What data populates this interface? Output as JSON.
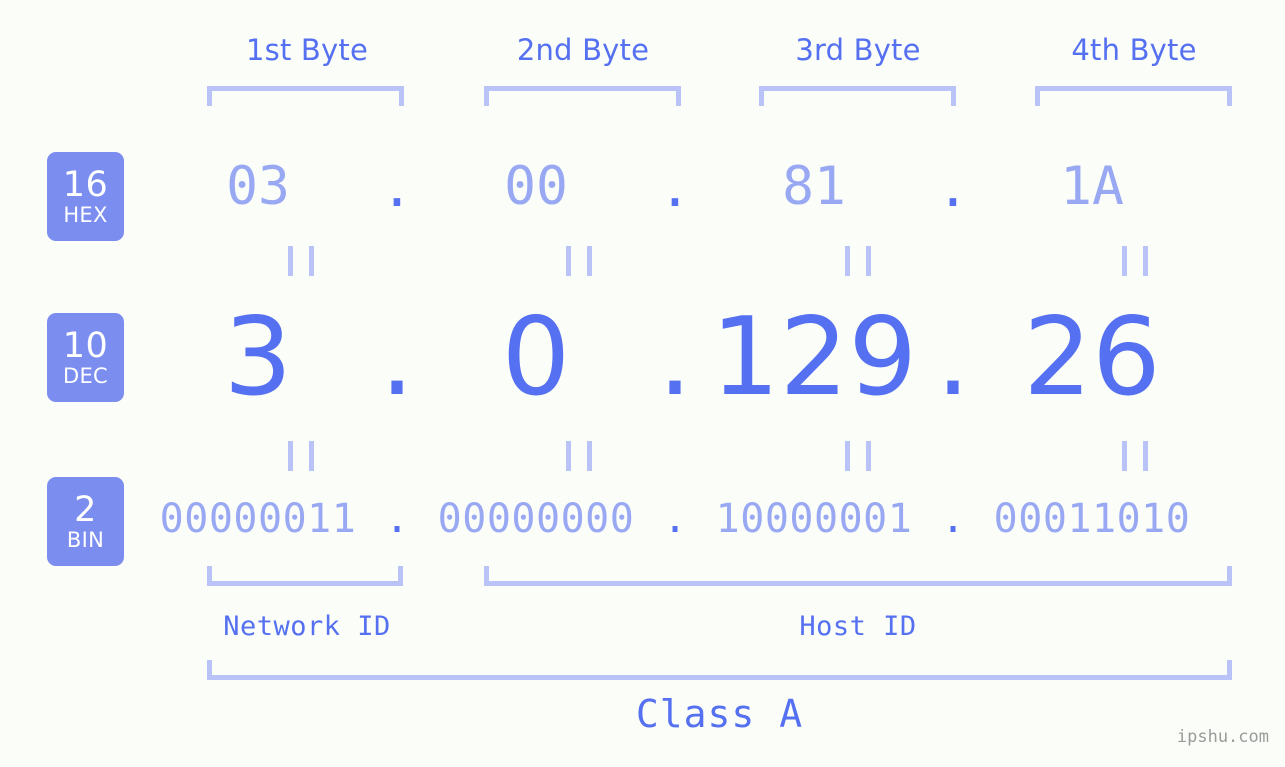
{
  "background_color": "#fbfdf9",
  "accent_color": "#5570f0",
  "accent_light_color": "#99a8f2",
  "bracket_color": "#b9c3f7",
  "badge_color": "#7b8ef0",
  "byte_headers": [
    {
      "label": "1st Byte"
    },
    {
      "label": "2nd Byte"
    },
    {
      "label": "3rd Byte"
    },
    {
      "label": "4th Byte"
    }
  ],
  "bases": [
    {
      "num": "16",
      "name": "HEX"
    },
    {
      "num": "10",
      "name": "DEC"
    },
    {
      "num": "2",
      "name": "BIN"
    }
  ],
  "separator": ".",
  "rows": {
    "hex": {
      "base_num": "16",
      "base_name": "HEX",
      "values": [
        "03",
        "00",
        "81",
        "1A"
      ]
    },
    "dec": {
      "base_num": "10",
      "base_name": "DEC",
      "values": [
        "3",
        "0",
        "129",
        "26"
      ]
    },
    "bin": {
      "base_num": "2",
      "base_name": "BIN",
      "values": [
        "00000011",
        "00000000",
        "10000001",
        "00011010"
      ]
    }
  },
  "address": {
    "hex": "03.00.81.1A",
    "dec": "3.0.129.26",
    "bin": "00000011.00000000.10000001.00011010"
  },
  "segments": {
    "network_id": "Network ID",
    "host_id": "Host ID",
    "class": "Class A"
  },
  "watermark": "ipshu.com"
}
